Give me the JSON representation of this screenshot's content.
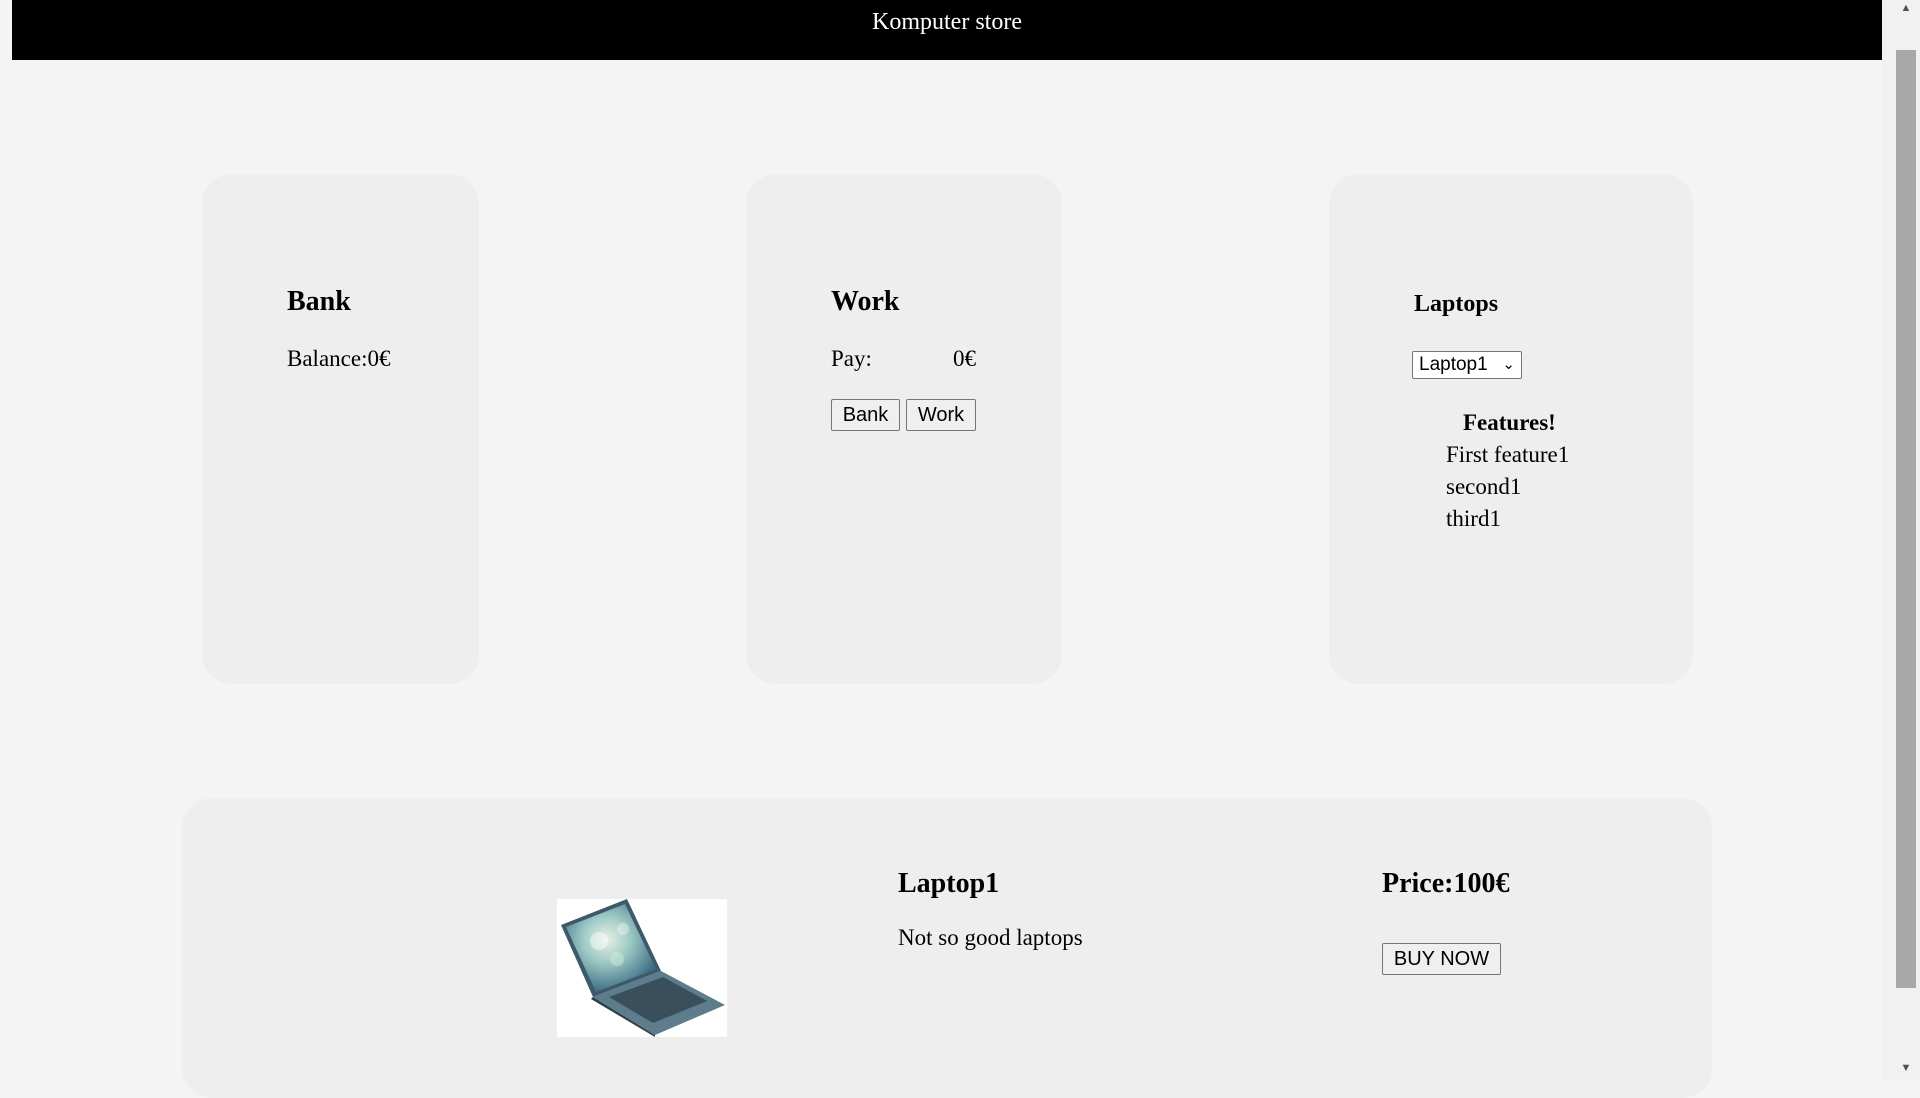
{
  "header": {
    "title": "Komputer store"
  },
  "bank": {
    "title": "Bank",
    "balance_label": "Balance:",
    "balance_value": "0€"
  },
  "work": {
    "title": "Work",
    "pay_label": "Pay:",
    "pay_value": "0€",
    "bank_button": "Bank",
    "work_button": "Work"
  },
  "laptops": {
    "title": "Laptops",
    "selected": "Laptop1",
    "features_title": "Features!",
    "features": [
      "First feature1",
      "second1",
      "third1"
    ]
  },
  "product": {
    "name": "Laptop1",
    "description": "Not so good laptops",
    "price_label": "Price:",
    "price_value": "100€",
    "buy_button": "BUY NOW",
    "image_icon": "laptop-image"
  }
}
